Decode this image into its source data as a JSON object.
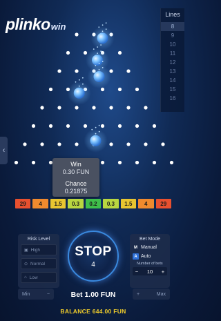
{
  "brand": {
    "name": "plinko",
    "suffix": "win"
  },
  "lines": {
    "title": "Lines",
    "options": [
      "8",
      "9",
      "10",
      "11",
      "12",
      "13",
      "14",
      "15",
      "16"
    ],
    "selected": "8"
  },
  "popup": {
    "win_label": "Win",
    "win_value": "0.30 FUN",
    "chance_label": "Chance",
    "chance_value": "0.21875"
  },
  "multipliers": [
    {
      "value": "29",
      "color": "#e8502f"
    },
    {
      "value": "4",
      "color": "#f08a2e"
    },
    {
      "value": "1.5",
      "color": "#e8c530"
    },
    {
      "value": "0.3",
      "color": "#b8d640"
    },
    {
      "value": "0.2",
      "color": "#3fbf4a"
    },
    {
      "value": "0.3",
      "color": "#b8d640"
    },
    {
      "value": "1.5",
      "color": "#e8c530"
    },
    {
      "value": "4",
      "color": "#f08a2e"
    },
    {
      "value": "29",
      "color": "#e8502f"
    }
  ],
  "risk": {
    "title": "Risk Level",
    "options": [
      "High",
      "Normal",
      "Low"
    ]
  },
  "min_label": "Min",
  "max_label": "Max",
  "stop": {
    "label": "STOP",
    "count": "4"
  },
  "bet_mode": {
    "title": "Bet Mode",
    "manual": "Manual",
    "auto": "Auto",
    "bets_label": "Number of bets",
    "bets_value": "10"
  },
  "bet_text": "Bet 1.00 FUN",
  "balance_text": "BALANCE 644.00 FUN",
  "colors": {
    "accent": "#3a8ae0",
    "balance": "#f3cf2b"
  }
}
